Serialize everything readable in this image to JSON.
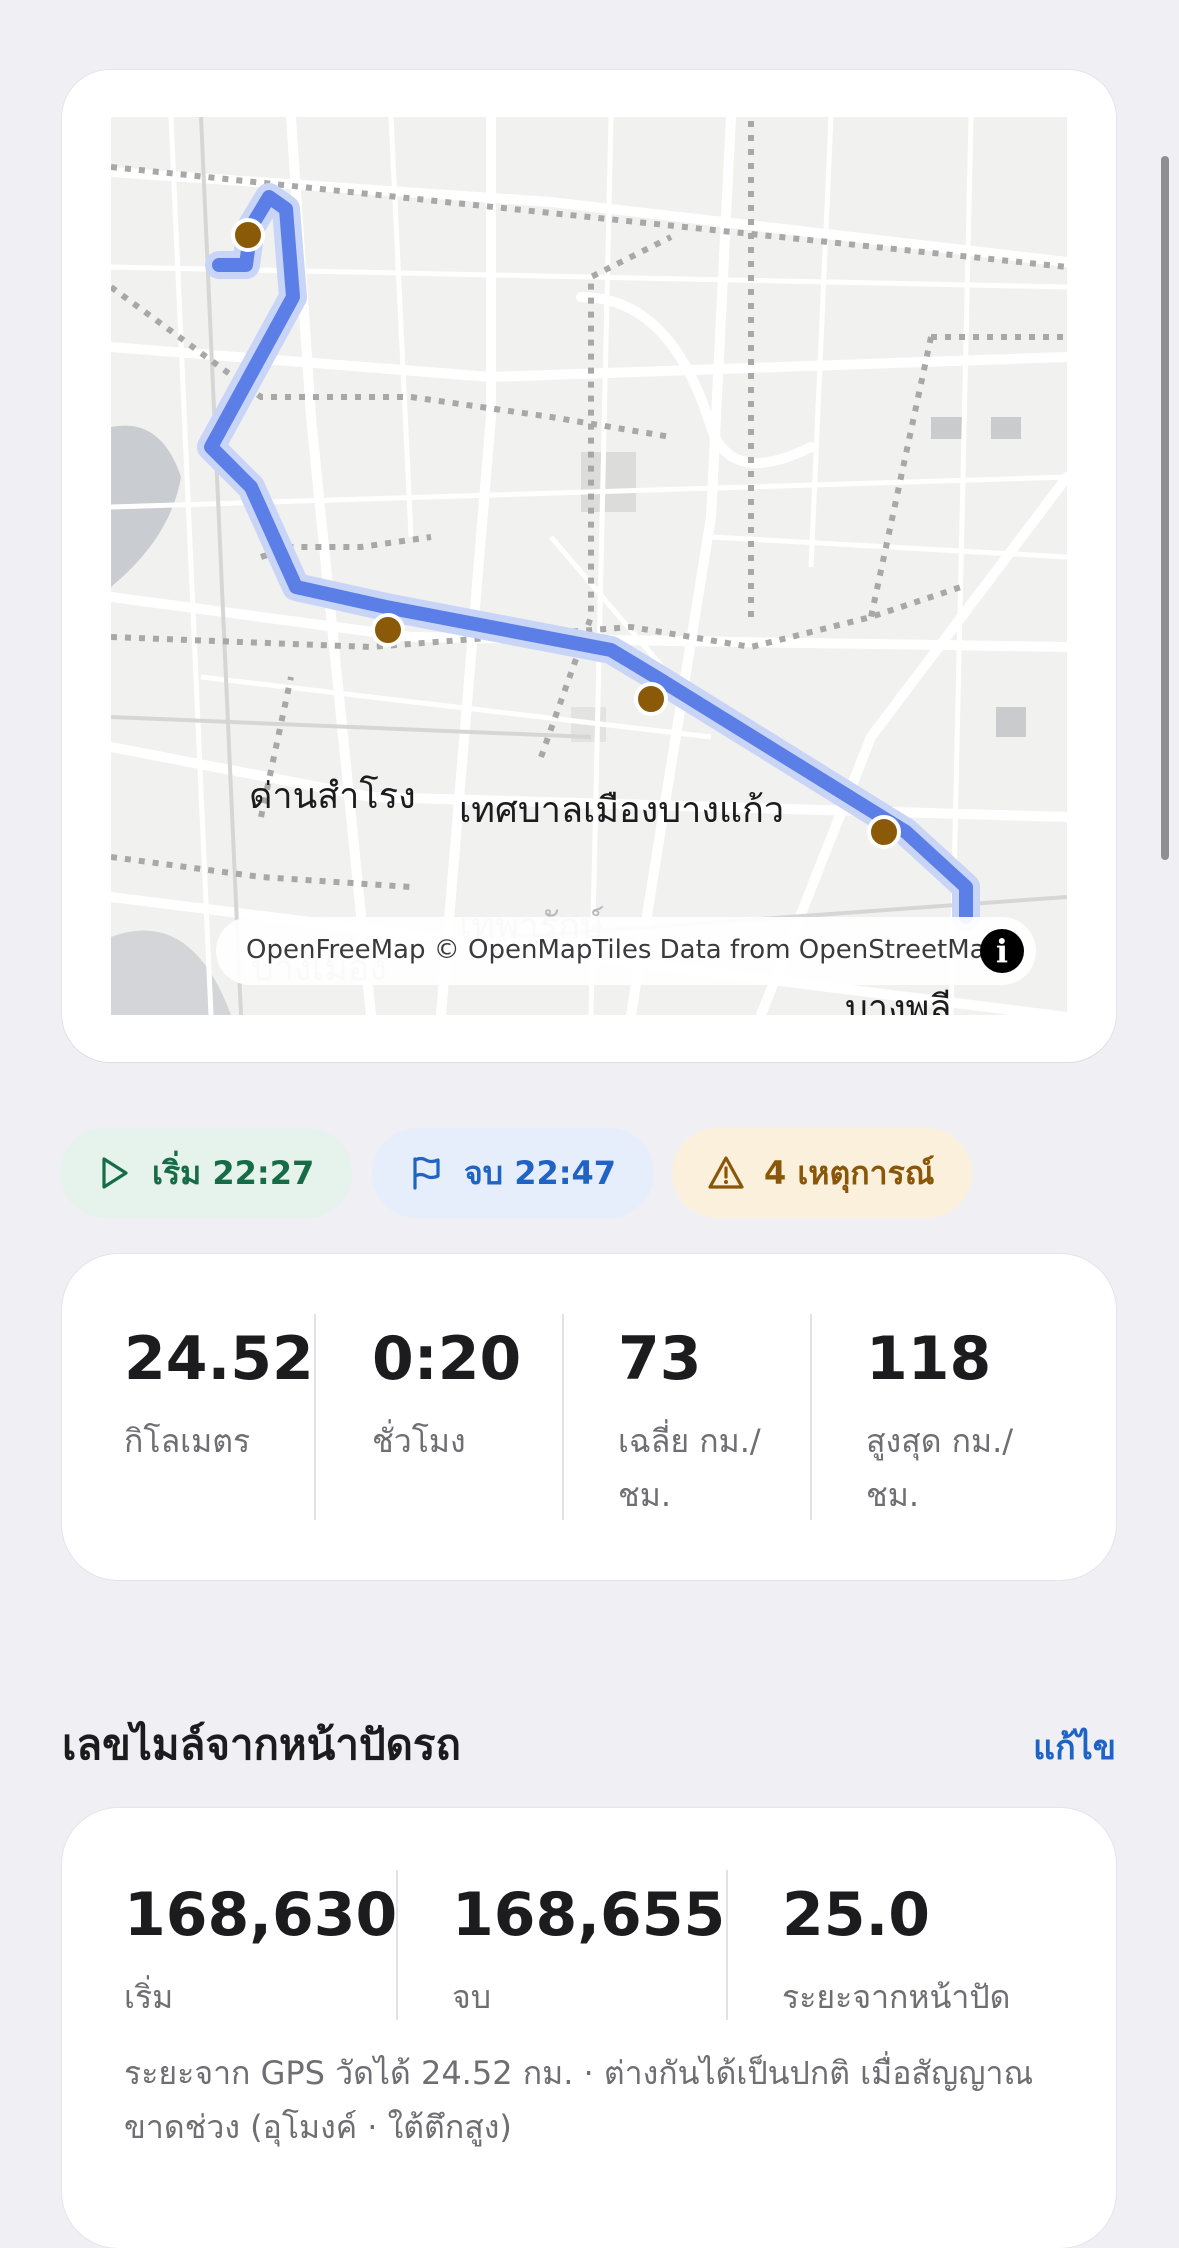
{
  "map": {
    "place_labels": [
      "ด่านสำโรง",
      "เทศบาลเมืองบางแก้ว",
      "เทพารักษ์",
      "บางเมือง",
      "บางพลี"
    ],
    "attribution": "OpenFreeMap © OpenMapTiles Data from OpenStreetMap",
    "info_icon_glyph": "i",
    "route_color": "#5b7fe6",
    "marker_color": "#8b5a08"
  },
  "chips": {
    "start": {
      "label": "เริ่ม 22:27",
      "icon": "play-icon"
    },
    "end": {
      "label": "จบ 22:47",
      "icon": "flag-icon"
    },
    "events": {
      "label": "4 เหตุการณ์",
      "icon": "warning-icon"
    }
  },
  "stats": [
    {
      "value": "24.52",
      "label": "กิโลเมตร"
    },
    {
      "value": "0:20",
      "label": "ชั่วโมง"
    },
    {
      "value": "73",
      "label": "เฉลี่ย กม./ชม."
    },
    {
      "value": "118",
      "label": "สูงสุด กม./ชม."
    }
  ],
  "odometer": {
    "title": "เลขไมล์จากหน้าปัดรถ",
    "edit_label": "แก้ไข",
    "items": [
      {
        "value": "168,630",
        "label": "เริ่ม"
      },
      {
        "value": "168,655",
        "label": "จบ"
      },
      {
        "value": "25.0",
        "label": "ระยะจากหน้าปัด"
      }
    ],
    "note": "ระยะจาก GPS วัดได้ 24.52 กม. · ต่างกันได้เป็นปกติ เมื่อสัญญาณขาดช่วง (อุโมงค์ · ใต้ตึกสูง)"
  }
}
